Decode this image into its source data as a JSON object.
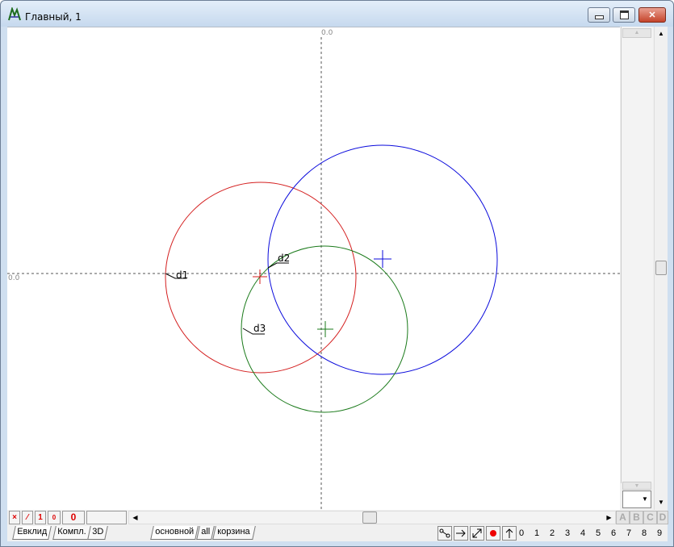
{
  "window": {
    "title": "Главный, 1"
  },
  "canvas": {
    "origin_x_label": "0.0",
    "origin_y_label": "0.0",
    "labels": [
      "d1",
      "d2",
      "d3"
    ],
    "colors": {
      "red": "#d41f1f",
      "blue": "#0a0adc",
      "green": "#1a7a1a",
      "axis": "#555555"
    }
  },
  "status_row": {
    "buttons": [
      "×",
      "⁄",
      "1",
      "0",
      "0"
    ],
    "side_letters": [
      "A",
      "B",
      "C",
      "D"
    ]
  },
  "tabs_left": [
    "Евклид",
    "Компл.",
    "3D"
  ],
  "tabs_right": [
    "основной",
    "all",
    "корзина"
  ],
  "tools": [
    "node-icon",
    "arrow-right-icon",
    "diagonal-arrow-icon",
    "red-dot-icon",
    "arrow-up-icon"
  ],
  "numbers": [
    "0",
    "1",
    "2",
    "3",
    "4",
    "5",
    "6",
    "7",
    "8",
    "9"
  ]
}
